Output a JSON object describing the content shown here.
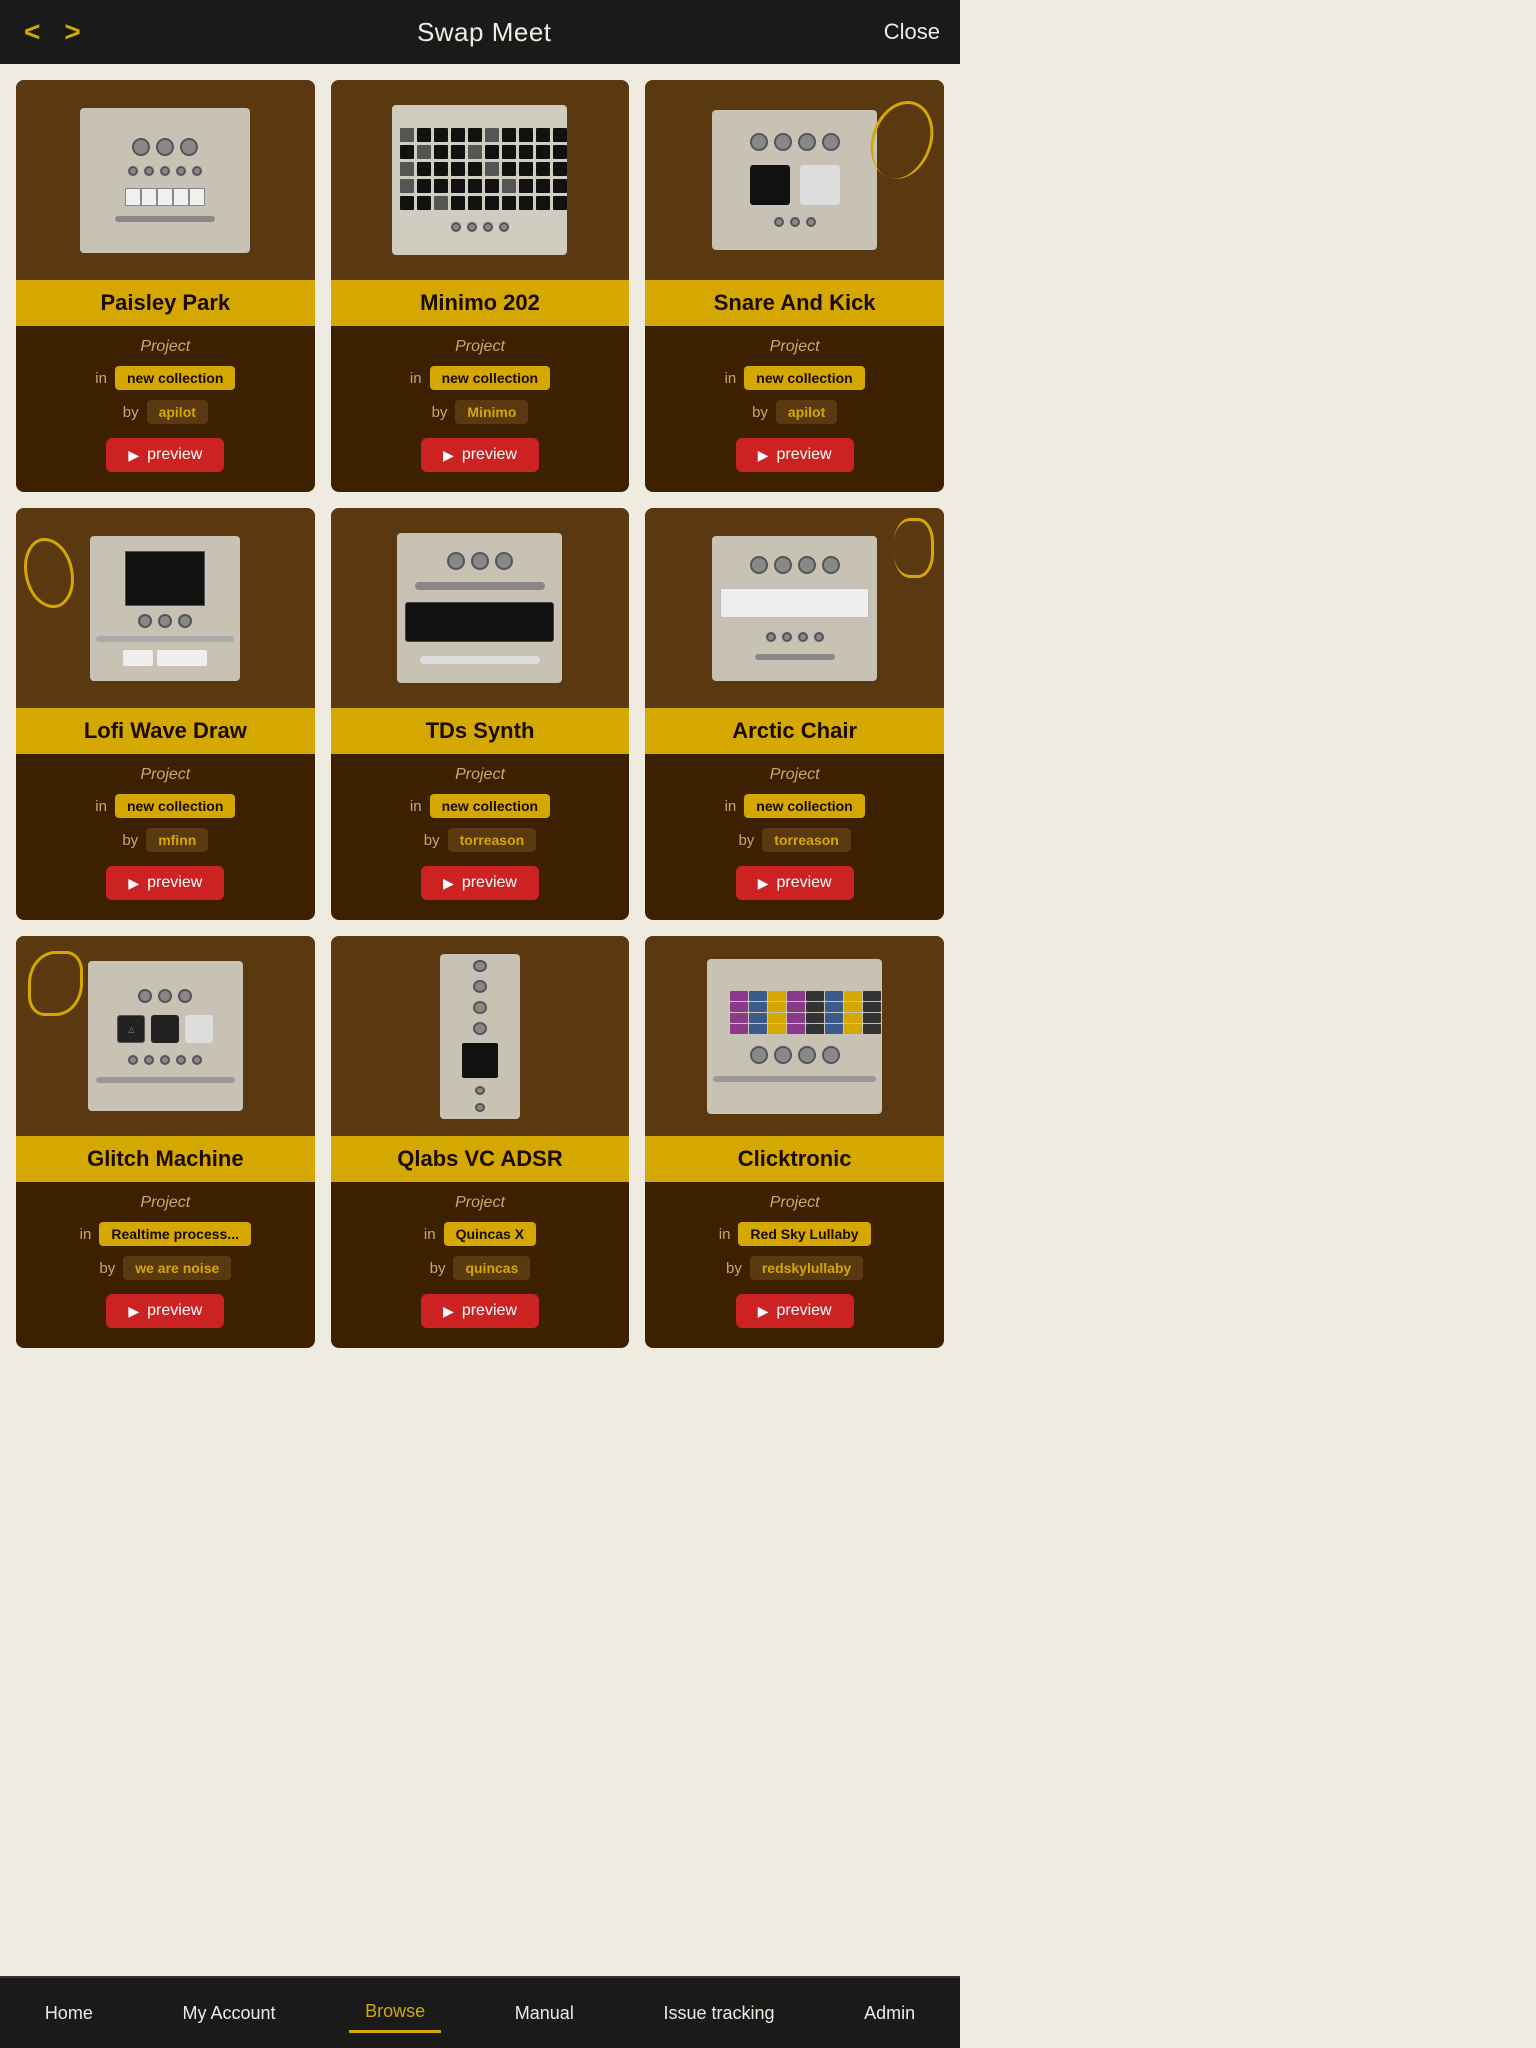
{
  "header": {
    "prev_label": "<",
    "next_label": ">",
    "title": "Swap Meet",
    "close_label": "Close"
  },
  "cards": [
    {
      "id": "paisley-park",
      "title": "Paisley Park",
      "type": "Project",
      "collection": "new collection",
      "author": "apilot",
      "author_style": "dark",
      "preview_label": "preview",
      "module_type": "paisley"
    },
    {
      "id": "minimo-202",
      "title": "Minimo 202",
      "type": "Project",
      "collection": "new collection",
      "author": "Minimo",
      "author_style": "dark",
      "preview_label": "preview",
      "module_type": "minimo"
    },
    {
      "id": "snare-and-kick",
      "title": "Snare And Kick",
      "type": "Project",
      "collection": "new collection",
      "author": "apilot",
      "author_style": "dark",
      "preview_label": "preview",
      "module_type": "snare"
    },
    {
      "id": "lofi-wave-draw",
      "title": "Lofi Wave Draw",
      "type": "Project",
      "collection": "new collection",
      "author": "mfinn",
      "author_style": "dark",
      "preview_label": "preview",
      "module_type": "lofi"
    },
    {
      "id": "tds-synth",
      "title": "TDs Synth",
      "type": "Project",
      "collection": "new collection",
      "author": "torreason",
      "author_style": "dark",
      "preview_label": "preview",
      "module_type": "tds"
    },
    {
      "id": "arctic-chair",
      "title": "Arctic Chair",
      "type": "Project",
      "collection": "new collection",
      "author": "torreason",
      "author_style": "dark",
      "preview_label": "preview",
      "module_type": "arctic"
    },
    {
      "id": "glitch-machine",
      "title": "Glitch Machine",
      "type": "Project",
      "collection": "Realtime process...",
      "author": "we are noise",
      "author_style": "dark",
      "preview_label": "preview",
      "module_type": "glitch"
    },
    {
      "id": "qlabs-vc-adsr",
      "title": "Qlabs VC ADSR",
      "type": "Project",
      "collection": "Quincas X",
      "author": "quincas",
      "author_style": "dark",
      "preview_label": "preview",
      "module_type": "qlabs"
    },
    {
      "id": "clicktronic",
      "title": "Clicktronic",
      "type": "Project",
      "collection": "Red Sky Lullaby",
      "author": "redskylullaby",
      "author_style": "dark",
      "preview_label": "preview",
      "module_type": "click"
    }
  ],
  "nav": {
    "items": [
      {
        "label": "Home",
        "active": false
      },
      {
        "label": "My Account",
        "active": false
      },
      {
        "label": "Browse",
        "active": true
      },
      {
        "label": "Manual",
        "active": false
      },
      {
        "label": "Issue tracking",
        "active": false
      },
      {
        "label": "Admin",
        "active": false
      }
    ]
  }
}
